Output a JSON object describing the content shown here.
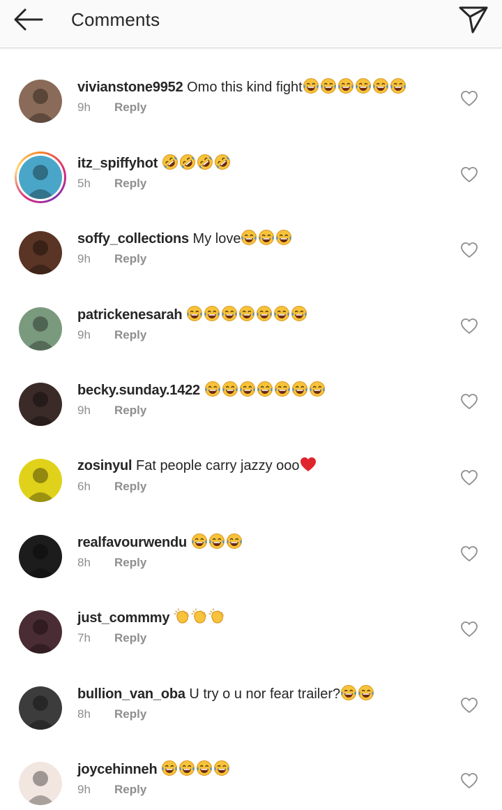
{
  "header": {
    "title": "Comments",
    "back_icon": "arrow-left-icon",
    "share_icon": "paper-plane-icon"
  },
  "reply_label": "Reply",
  "comments": [
    {
      "username": "vivianstone9952",
      "text": "Omo this kind fight",
      "emoji": "tears-of-joy",
      "emoji_count": 6,
      "time": "9h",
      "avatar_bg": "#8a6a58",
      "story": false
    },
    {
      "username": "itz_spiffyhot",
      "text": "",
      "emoji": "rolling-on-floor-laughing",
      "emoji_count": 4,
      "time": "5h",
      "avatar_bg": "#4aa6c8",
      "story": true
    },
    {
      "username": "soffy_collections",
      "text": "My love",
      "emoji": "tears-of-joy",
      "emoji_count": 3,
      "time": "9h",
      "avatar_bg": "#5a3424",
      "story": false
    },
    {
      "username": "patrickenesarah",
      "text": "",
      "emoji": "tears-of-joy",
      "emoji_count": 7,
      "time": "9h",
      "avatar_bg": "#7a9a7e",
      "story": false
    },
    {
      "username": "becky.sunday.1422",
      "text": "",
      "emoji": "tears-of-joy",
      "emoji_count": 7,
      "time": "9h",
      "avatar_bg": "#3a2a28",
      "story": false
    },
    {
      "username": "zosinyul",
      "text": "Fat people carry jazzy ooo",
      "emoji": "red-heart",
      "emoji_count": 1,
      "time": "6h",
      "avatar_bg": "#e0d21a",
      "story": false
    },
    {
      "username": "realfavourwendu",
      "text": "",
      "emoji": "tears-of-joy",
      "emoji_count": 3,
      "time": "8h",
      "avatar_bg": "#1c1c1c",
      "story": false
    },
    {
      "username": "just_commmy",
      "text": "",
      "emoji": "clapping-hands",
      "emoji_count": 3,
      "time": "7h",
      "avatar_bg": "#4a2c34",
      "story": false
    },
    {
      "username": "bullion_van_oba",
      "text": "U try o u nor fear trailer?",
      "emoji": "tears-of-joy",
      "emoji_count": 2,
      "time": "8h",
      "avatar_bg": "#3c3c3c",
      "story": false
    },
    {
      "username": "joycehinneh",
      "text": "",
      "emoji": "tears-of-joy",
      "emoji_count": 4,
      "time": "9h",
      "avatar_bg": "#f2e6e0",
      "story": false
    }
  ],
  "colors": {
    "header_bg": "#fafafa",
    "meta_text": "#8e8e8e",
    "body_text": "#262626",
    "emoji_face": "#f7c33a",
    "tear": "#3b8fe0",
    "heart": "#e0242c"
  }
}
